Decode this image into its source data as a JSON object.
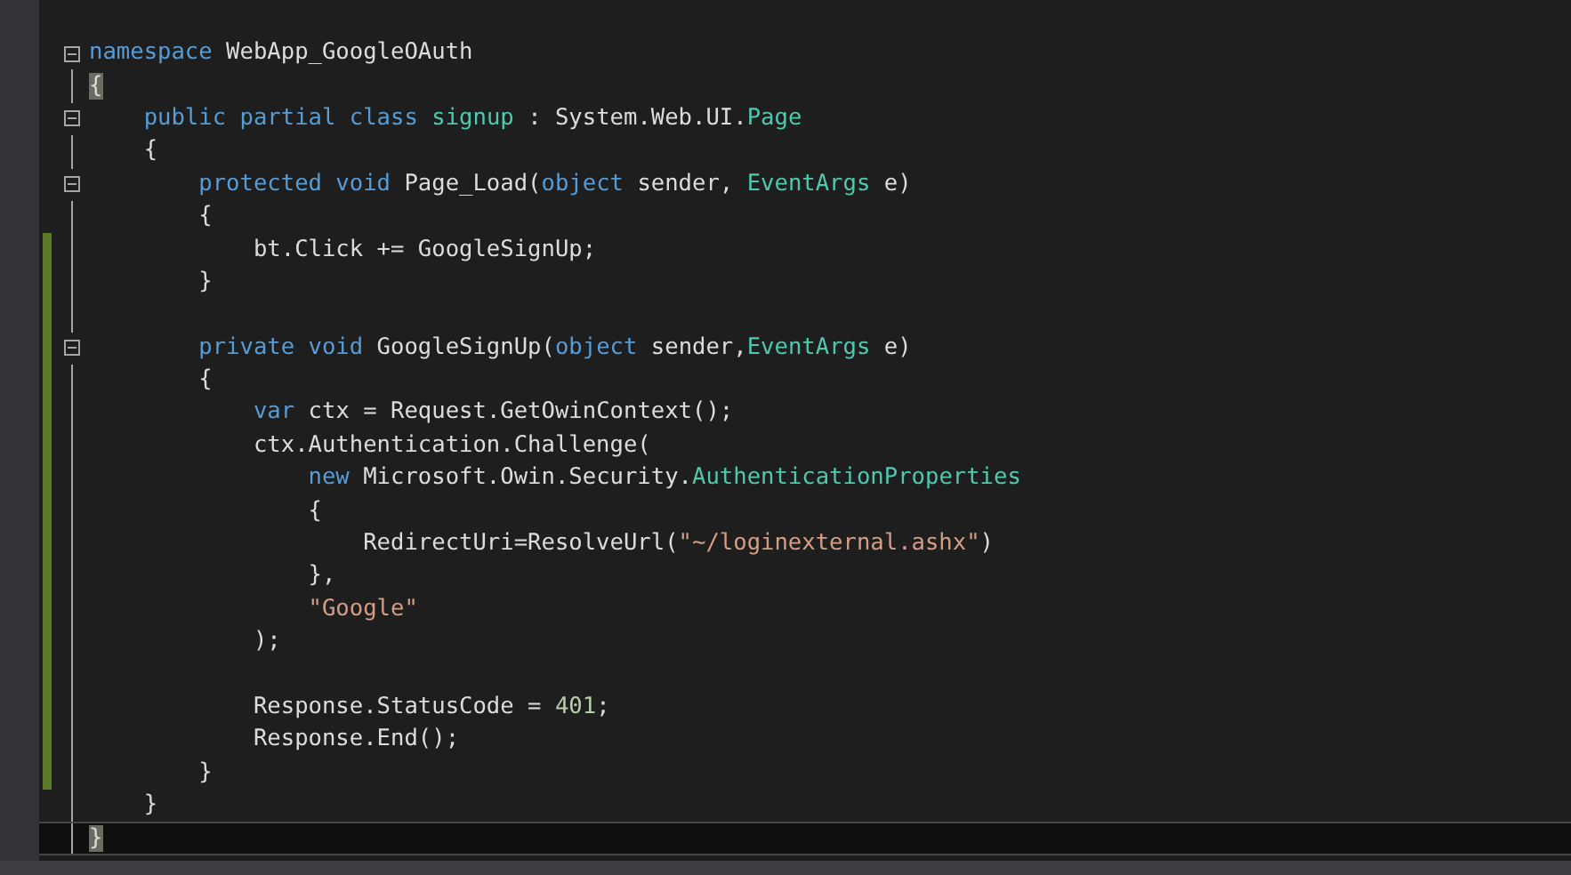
{
  "editor": {
    "lines": [
      {
        "fold": true,
        "changed": false,
        "current": false,
        "tokens": [
          {
            "kind": "keyword",
            "text": "namespace"
          },
          {
            "kind": "plain",
            "text": " WebApp_GoogleOAuth"
          }
        ]
      },
      {
        "fold": false,
        "changed": false,
        "current": false,
        "tokens": [
          {
            "kind": "brace_match",
            "text": "{"
          }
        ]
      },
      {
        "fold": true,
        "changed": false,
        "current": false,
        "tokens": [
          {
            "kind": "keyword",
            "text": "    public partial class "
          },
          {
            "kind": "type",
            "text": "signup"
          },
          {
            "kind": "plain",
            "text": " : System.Web.UI."
          },
          {
            "kind": "type",
            "text": "Page"
          }
        ]
      },
      {
        "fold": false,
        "changed": false,
        "current": false,
        "tokens": [
          {
            "kind": "plain",
            "text": "    {"
          }
        ]
      },
      {
        "fold": true,
        "changed": false,
        "current": false,
        "tokens": [
          {
            "kind": "keyword",
            "text": "        protected void"
          },
          {
            "kind": "plain",
            "text": " Page_Load("
          },
          {
            "kind": "keyword",
            "text": "object"
          },
          {
            "kind": "plain",
            "text": " sender, "
          },
          {
            "kind": "type",
            "text": "EventArgs"
          },
          {
            "kind": "plain",
            "text": " e)"
          }
        ]
      },
      {
        "fold": false,
        "changed": false,
        "current": false,
        "tokens": [
          {
            "kind": "plain",
            "text": "        {"
          }
        ]
      },
      {
        "fold": false,
        "changed": true,
        "current": false,
        "tokens": [
          {
            "kind": "plain",
            "text": "            bt.Click += GoogleSignUp;"
          }
        ]
      },
      {
        "fold": false,
        "changed": true,
        "current": false,
        "tokens": [
          {
            "kind": "plain",
            "text": "        }"
          }
        ]
      },
      {
        "fold": false,
        "changed": true,
        "current": false
      },
      {
        "fold": true,
        "changed": true,
        "current": false,
        "tokens": [
          {
            "kind": "keyword",
            "text": "        private void"
          },
          {
            "kind": "plain",
            "text": " GoogleSignUp("
          },
          {
            "kind": "keyword",
            "text": "object"
          },
          {
            "kind": "plain",
            "text": " sender,"
          },
          {
            "kind": "type",
            "text": "EventArgs"
          },
          {
            "kind": "plain",
            "text": " e)"
          }
        ]
      },
      {
        "fold": false,
        "changed": true,
        "current": false,
        "tokens": [
          {
            "kind": "plain",
            "text": "        {"
          }
        ]
      },
      {
        "fold": false,
        "changed": true,
        "current": false,
        "tokens": [
          {
            "kind": "keyword",
            "text": "            var"
          },
          {
            "kind": "plain",
            "text": " ctx = Request.GetOwinContext();"
          }
        ]
      },
      {
        "fold": false,
        "changed": true,
        "current": false,
        "tokens": [
          {
            "kind": "plain",
            "text": "            ctx.Authentication.Challenge("
          }
        ]
      },
      {
        "fold": false,
        "changed": true,
        "current": false,
        "tokens": [
          {
            "kind": "keyword",
            "text": "                new"
          },
          {
            "kind": "plain",
            "text": " Microsoft.Owin.Security."
          },
          {
            "kind": "type",
            "text": "AuthenticationProperties"
          }
        ]
      },
      {
        "fold": false,
        "changed": true,
        "current": false,
        "tokens": [
          {
            "kind": "plain",
            "text": "                {"
          }
        ]
      },
      {
        "fold": false,
        "changed": true,
        "current": false,
        "tokens": [
          {
            "kind": "plain",
            "text": "                    RedirectUri=ResolveUrl("
          },
          {
            "kind": "string",
            "text": "\"~/loginexternal.ashx\""
          },
          {
            "kind": "plain",
            "text": ")"
          }
        ]
      },
      {
        "fold": false,
        "changed": true,
        "current": false,
        "tokens": [
          {
            "kind": "plain",
            "text": "                },"
          }
        ]
      },
      {
        "fold": false,
        "changed": true,
        "current": false,
        "tokens": [
          {
            "kind": "string",
            "text": "                \"Google\""
          }
        ]
      },
      {
        "fold": false,
        "changed": true,
        "current": false,
        "tokens": [
          {
            "kind": "plain",
            "text": "            );"
          }
        ]
      },
      {
        "fold": false,
        "changed": true,
        "current": false
      },
      {
        "fold": false,
        "changed": true,
        "current": false,
        "tokens": [
          {
            "kind": "plain",
            "text": "            Response.StatusCode = "
          },
          {
            "kind": "number",
            "text": "401"
          },
          {
            "kind": "plain",
            "text": ";"
          }
        ]
      },
      {
        "fold": false,
        "changed": true,
        "current": false,
        "tokens": [
          {
            "kind": "plain",
            "text": "            Response.End();"
          }
        ]
      },
      {
        "fold": false,
        "changed": true,
        "current": false,
        "tokens": [
          {
            "kind": "plain",
            "text": "        }"
          }
        ]
      },
      {
        "fold": false,
        "changed": false,
        "current": false,
        "tokens": [
          {
            "kind": "plain",
            "text": "    }"
          }
        ]
      },
      {
        "fold": false,
        "changed": false,
        "current": true,
        "tokens": [
          {
            "kind": "brace_match",
            "text": "}"
          }
        ]
      }
    ]
  }
}
